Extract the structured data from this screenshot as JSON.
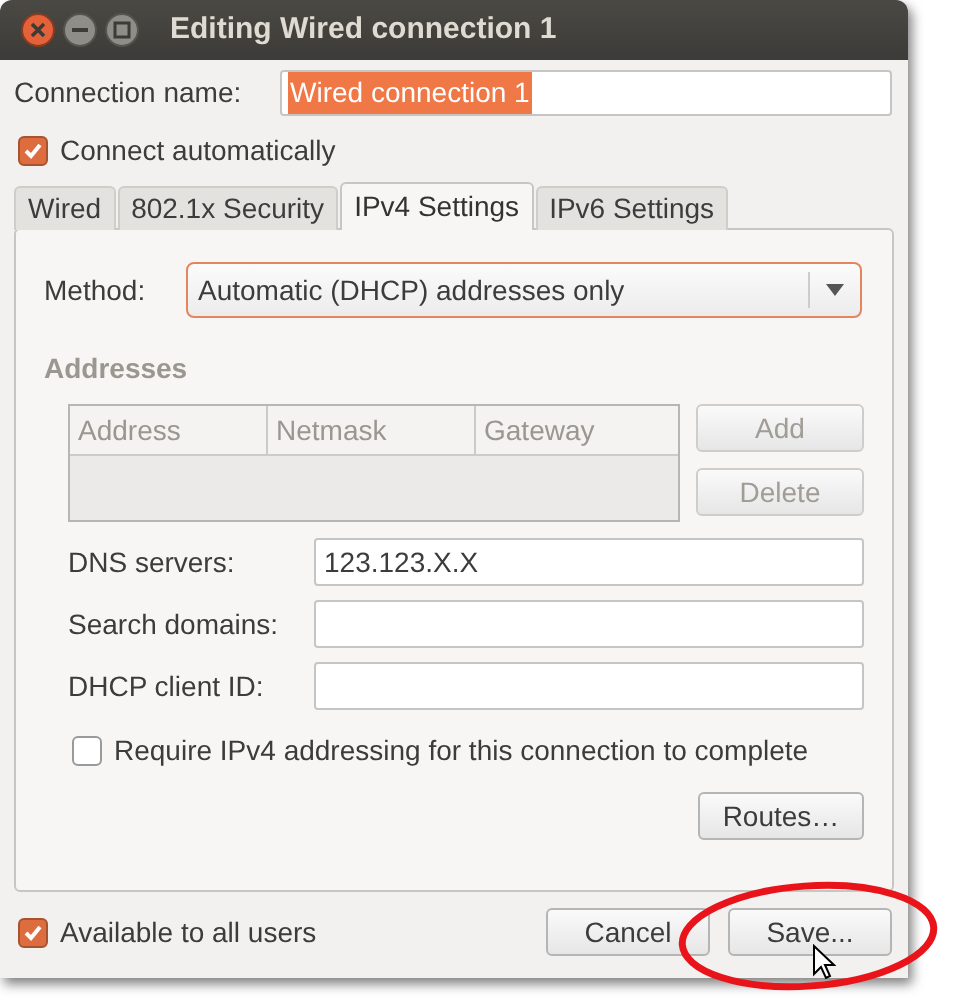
{
  "window": {
    "title": "Editing Wired connection 1"
  },
  "connection_name": {
    "label": "Connection name:",
    "value": "Wired connection 1",
    "text_selected": true
  },
  "connect_automatically": {
    "label": "Connect automatically",
    "checked": true
  },
  "tabs": [
    {
      "label": "Wired",
      "selected": false
    },
    {
      "label": "802.1x Security",
      "selected": false
    },
    {
      "label": "IPv4 Settings",
      "selected": true
    },
    {
      "label": "IPv6 Settings",
      "selected": false
    }
  ],
  "method": {
    "label": "Method:",
    "value": "Automatic (DHCP) addresses only"
  },
  "addresses": {
    "title": "Addresses",
    "disabled": true,
    "columns": [
      "Address",
      "Netmask",
      "Gateway"
    ],
    "buttons": [
      {
        "label": "Add",
        "disabled": true
      },
      {
        "label": "Delete",
        "disabled": true
      }
    ]
  },
  "fields": [
    {
      "label": "DNS servers:",
      "value": "123.123.X.X"
    },
    {
      "label": "Search domains:"
    },
    {
      "label": "DHCP client ID:"
    }
  ],
  "require_ipv4": {
    "label": "Require IPv4 addressing for this connection to complete",
    "checked": false
  },
  "routes_button": "Routes…",
  "available_to_all": {
    "label": "Available to all users",
    "checked": true
  },
  "buttons": [
    {
      "label": "Cancel"
    },
    {
      "label": "Save..."
    }
  ]
}
